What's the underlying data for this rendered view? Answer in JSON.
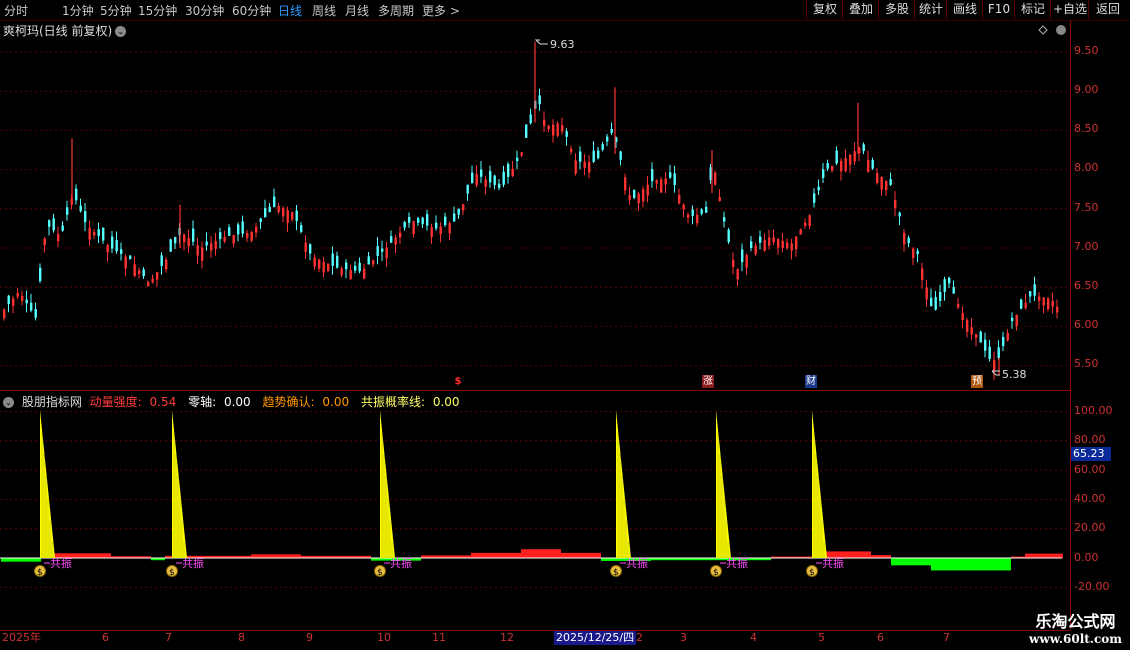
{
  "toolbar": {
    "periods": [
      "分时",
      "1分钟",
      "5分钟",
      "15分钟",
      "30分钟",
      "60分钟",
      "日线",
      "周线",
      "月线",
      "多周期",
      "更多 >"
    ],
    "active_period": "日线",
    "right_buttons": [
      "复权",
      "叠加",
      "多股",
      "统计",
      "画线",
      "F10",
      "标记",
      "+自选",
      "返回"
    ]
  },
  "stock": {
    "title": "爽柯玛(日线 前复权)",
    "high_label": "9.63",
    "low_label": "5.38"
  },
  "price_axis": [
    "9.50",
    "9.00",
    "8.50",
    "8.00",
    "7.50",
    "7.00",
    "6.50",
    "6.00",
    "5.50"
  ],
  "signals": [
    "$",
    "涨",
    "财",
    "预"
  ],
  "indicator": {
    "name": "股朋指标网",
    "fields": [
      {
        "label": "动量强度:",
        "value": "0.54",
        "color": "#ff3c3c"
      },
      {
        "label": "零轴:",
        "value": "0.00",
        "color": "#ffffff"
      },
      {
        "label": "趋势确认:",
        "value": "0.00",
        "color": "#ff9900"
      },
      {
        "label": "共振概率线:",
        "value": "0.00",
        "color": "#ffff66"
      }
    ],
    "axis": [
      "100.00",
      "80.00",
      "60.00",
      "40.00",
      "20.00",
      "0.00",
      "-20.00"
    ],
    "current_value": "65.23",
    "resonance_label": "共振"
  },
  "dates": [
    "2025年",
    "6",
    "7",
    "8",
    "9",
    "10",
    "11",
    "12",
    "2025/12/25/四",
    "2",
    "3",
    "4",
    "5",
    "6",
    "7"
  ],
  "watermark": {
    "line1": "乐淘公式网",
    "line2": "www.60lt.com"
  },
  "colors": {
    "up": "#ff3232",
    "down": "#54ffff",
    "peak": "#ffff00",
    "hist_up": "#ff2020",
    "hist_down": "#00ff00",
    "accent": "#2e9bff"
  }
}
